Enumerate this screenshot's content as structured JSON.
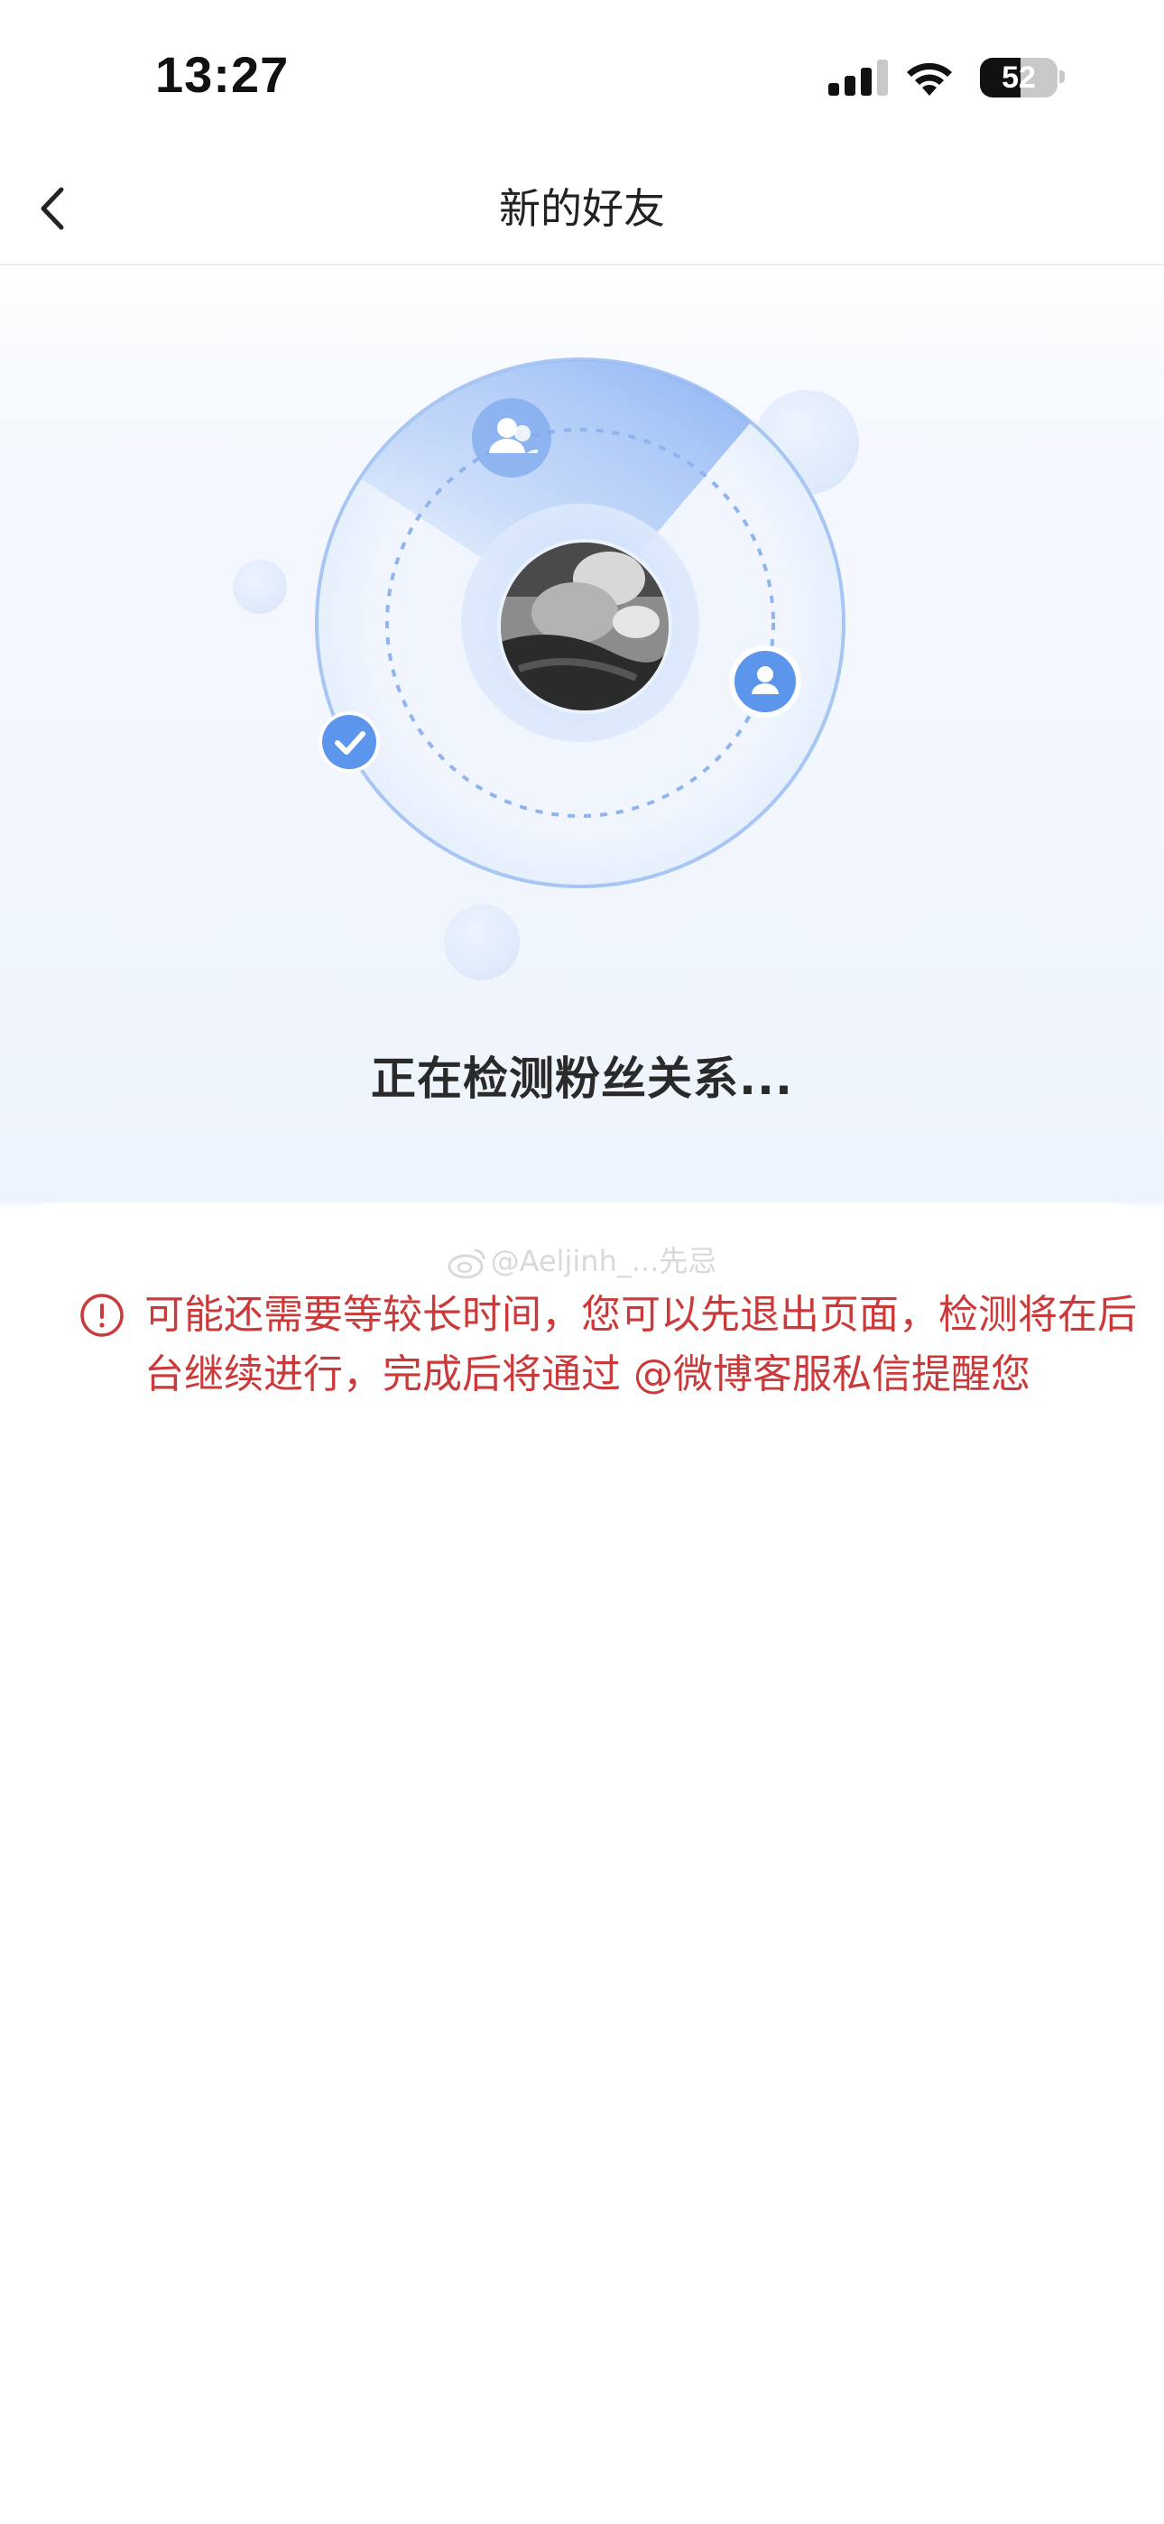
{
  "status_bar": {
    "time": "13:27",
    "battery_level": "52",
    "battery_percent": 52
  },
  "nav": {
    "title": "新的好友",
    "back_icon": "chevron-left-icon"
  },
  "radar": {
    "status_text": "正在检测粉丝关系...",
    "icons": [
      "users-icon",
      "user-icon",
      "check-icon"
    ]
  },
  "card": {
    "watermark": "@Aeljinh_...先忌",
    "notice_icon": "alert-circle-icon",
    "notice_text": "可能还需要等较长时间，您可以先退出页面，检测将在后台继续进行，完成后将通过 @微博客服私信提醒您"
  },
  "colors": {
    "accent_blue": "#5b95ec",
    "notice_red": "#cb3a3a",
    "title_text": "#222222"
  }
}
